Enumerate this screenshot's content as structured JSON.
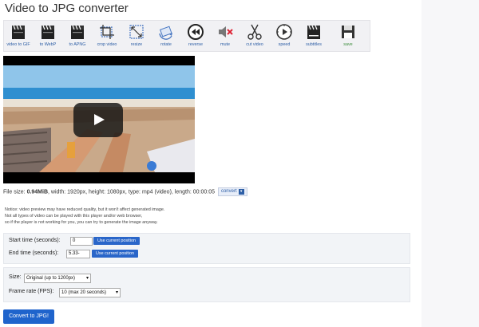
{
  "page_title": "Video to JPG converter",
  "toolbar": {
    "tools": [
      {
        "label": "video to GIF",
        "icon": "clapperboard-gif-icon"
      },
      {
        "label": "to WebP",
        "icon": "clapperboard-webp-icon"
      },
      {
        "label": "to APNG",
        "icon": "clapperboard-apng-icon"
      },
      {
        "label": "crop video",
        "icon": "crop-icon"
      },
      {
        "label": "resize",
        "icon": "resize-icon"
      },
      {
        "label": "rotate",
        "icon": "rotate-icon"
      },
      {
        "label": "reverse",
        "icon": "reverse-icon"
      },
      {
        "label": "mute",
        "icon": "mute-icon"
      },
      {
        "label": "cut video",
        "icon": "scissors-icon"
      },
      {
        "label": "speed",
        "icon": "speed-icon"
      },
      {
        "label": "subtitles",
        "icon": "subtitles-icon"
      },
      {
        "label": "save",
        "icon": "save-icon"
      }
    ]
  },
  "file_info": {
    "prefix": "File size: ",
    "size": "0.94MiB",
    "details": ", width: 1920px, height: 1080px, type: mp4 (video), length: 00:00:05",
    "convert_label": "convert"
  },
  "notice": [
    "Notice: video preview may have reduced quality, but it won't affect generated image.",
    "Not all types of video can be played with this player and/or web browser,",
    "so if the player is not working for you, you can try to generate the image anyway."
  ],
  "start_time": {
    "label": "Start time (seconds):",
    "value": "0",
    "button": "Use current position"
  },
  "end_time": {
    "label": "End time (seconds):",
    "value": "5.33-",
    "button": "Use current position"
  },
  "size": {
    "label": "Size:",
    "selected": "Original (up to 1200px)"
  },
  "frame_rate": {
    "label": "Frame rate (FPS):",
    "selected": "10 (max 20 seconds)"
  },
  "convert_button": "Convert to JPG!",
  "colors": {
    "accent": "#1f64cc",
    "link": "#2e5fa6",
    "panel": "#f2f4f7"
  }
}
